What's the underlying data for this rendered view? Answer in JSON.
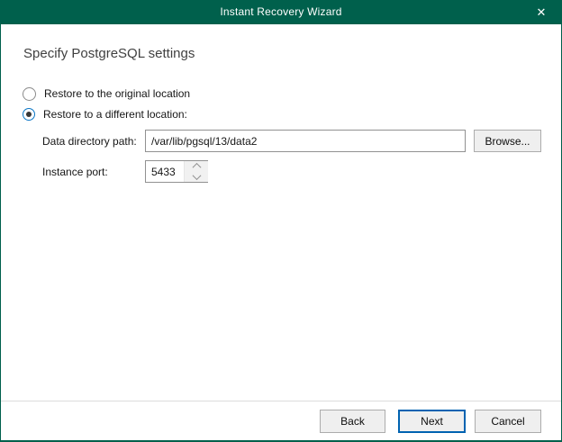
{
  "window": {
    "title": "Instant Recovery Wizard"
  },
  "icons": {
    "close": "✕"
  },
  "colors": {
    "accent": "#00604C",
    "radio_selected_ring": "#0B77C6",
    "next_button_border": "#0063B1"
  },
  "main": {
    "heading": "Specify PostgreSQL settings",
    "options": [
      {
        "label": "Restore to the original location",
        "selected": false
      },
      {
        "label": "Restore to a different location:",
        "selected": true
      }
    ],
    "data_directory": {
      "label": "Data directory path:",
      "value": "/var/lib/pgsql/13/data2",
      "browse_label": "Browse..."
    },
    "instance_port": {
      "label": "Instance port:",
      "value": "5433"
    }
  },
  "footer": {
    "back": "Back",
    "next": "Next",
    "cancel": "Cancel"
  }
}
